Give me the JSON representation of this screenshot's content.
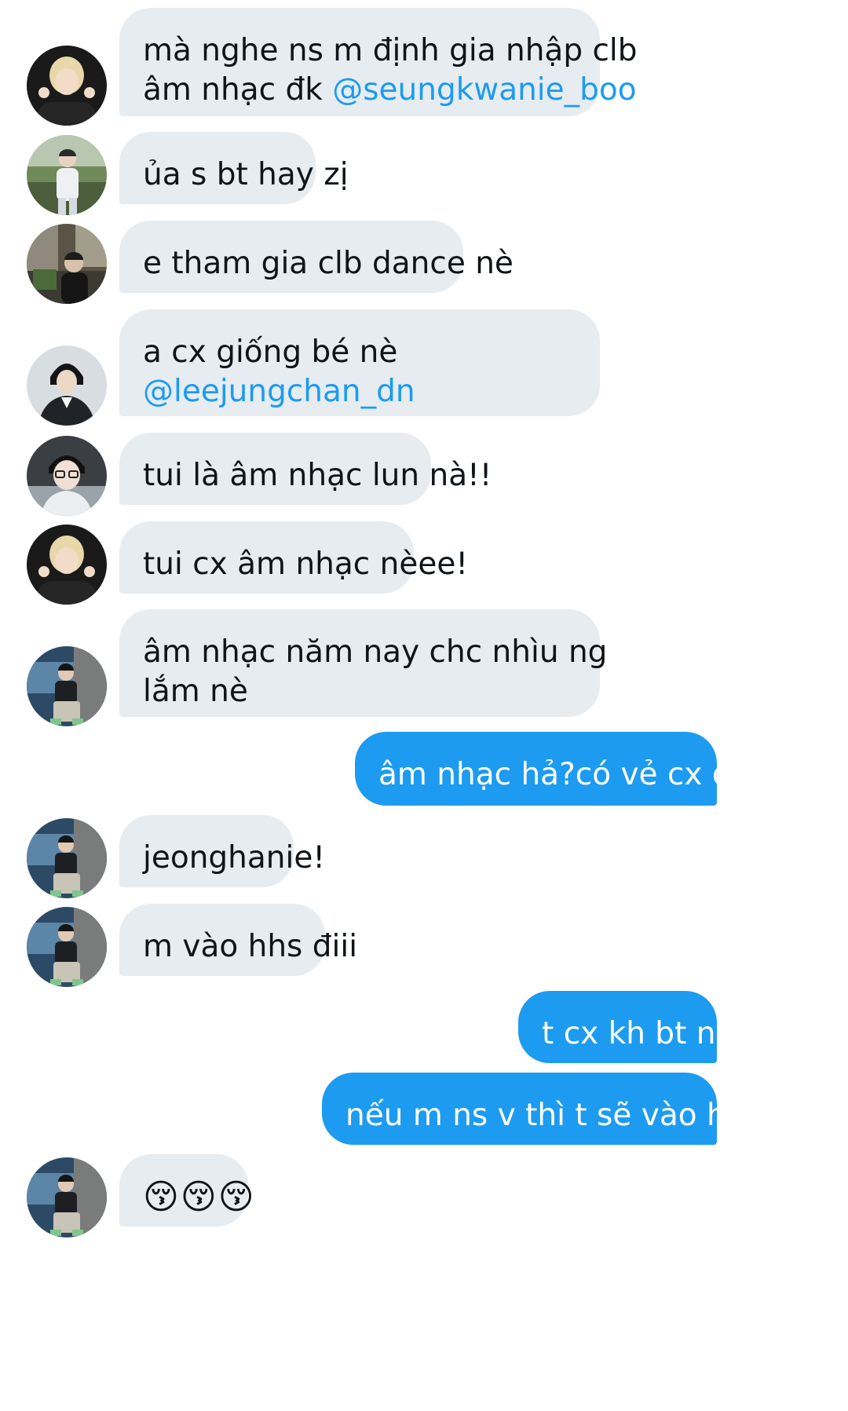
{
  "colors": {
    "incoming_bubble": "#e6ecf0",
    "outgoing_bubble": "#1d9bf0",
    "mention": "#1d9bf0"
  },
  "messages": [
    {
      "direction": "in",
      "avatar": "avatar-blonde-hair",
      "line1": "mà nghe ns m định gia nhập clb",
      "line2_text": "âm nhạc đk ",
      "mention": "@seungkwanie_boo"
    },
    {
      "direction": "in",
      "avatar": "avatar-outdoor-white-shirt",
      "text": "ủa s bt hay zị"
    },
    {
      "direction": "in",
      "avatar": "avatar-street-dark",
      "text": "e tham gia clb dance nè"
    },
    {
      "direction": "in",
      "avatar": "avatar-black-jacket",
      "line1": "a cx giống bé nè",
      "mention": "@leejungchan_dn"
    },
    {
      "direction": "in",
      "avatar": "avatar-glasses-selfie",
      "text": "tui là âm nhạc lun nà!!"
    },
    {
      "direction": "in",
      "avatar": "avatar-blonde-hair",
      "text": "tui cx âm nhạc nèee!"
    },
    {
      "direction": "in",
      "avatar": "avatar-city-sitting",
      "line1": "âm nhạc năm nay chc nhìu ng",
      "line2_text": "lắm nè"
    },
    {
      "direction": "out",
      "text": "âm nhạc hả?có vẻ cx đc!"
    },
    {
      "direction": "in",
      "avatar": "avatar-city-sitting",
      "text": "jeonghanie!"
    },
    {
      "direction": "in",
      "avatar": "avatar-city-sitting",
      "text": "m vào hhs điii"
    },
    {
      "direction": "out",
      "text": "t cx kh bt nx"
    },
    {
      "direction": "out",
      "text": "nếu m ns v thì t sẽ vào hhs!"
    },
    {
      "direction": "in",
      "avatar": "avatar-city-sitting",
      "text": "😚😚😚"
    }
  ]
}
